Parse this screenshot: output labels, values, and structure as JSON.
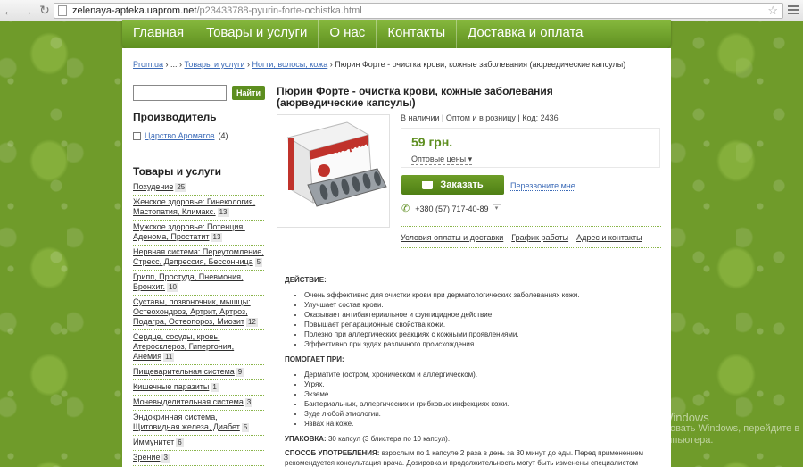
{
  "browser": {
    "url_host": "zelenaya-apteka.uaprom.net",
    "url_path": "/p23433788-pyurin-forte-ochistka.html"
  },
  "nav": [
    "Главная",
    "Товары и услуги",
    "О нас",
    "Контакты",
    "Доставка и оплата"
  ],
  "breadcrumb": {
    "items": [
      "Prom.ua",
      "...",
      "Товары и услуги",
      "Ногти, волосы, кожа"
    ],
    "current": "Пюрин Форте - очистка крови, кожные заболевания (аюрведические капсулы)"
  },
  "search": {
    "button": "Найти",
    "placeholder": ""
  },
  "sidebar": {
    "manufacturer_title": "Производитель",
    "manufacturer": {
      "name": "Царство Ароматов",
      "count": "(4)"
    },
    "categories_title": "Товары и услуги",
    "categories": [
      {
        "label": "Похудение",
        "count": "25"
      },
      {
        "label": "Женское здоровье: Гинекология, Мастопатия, Климакс.",
        "count": "13"
      },
      {
        "label": "Мужское здоровье: Потенция, Аденома, Простатит",
        "count": "13"
      },
      {
        "label": "Нервная система: Переутомление, Стресс, Депрессия, Бессонница",
        "count": "5"
      },
      {
        "label": "Грипп, Простуда, Пневмония, Бронхит.",
        "count": "10"
      },
      {
        "label": "Суставы, позвоночник, мышцы: Остеохондроз, Артрит, Артроз, Подагра, Остеопороз, Миозит",
        "count": "12"
      },
      {
        "label": "Сердце, сосуды, кровь: Атеросклероз, Гипертония, Анемия",
        "count": "11"
      },
      {
        "label": "Пищеварительная система",
        "count": "9"
      },
      {
        "label": "Кишечные паразиты",
        "count": "1"
      },
      {
        "label": "Мочевыделительная система",
        "count": "3"
      },
      {
        "label": "Эндокринная система, Щитовидная железа, Диабет",
        "count": "5"
      },
      {
        "label": "Иммунитет",
        "count": "6"
      },
      {
        "label": "Зрение",
        "count": "3"
      }
    ]
  },
  "product": {
    "title": "Пюрин Форте - очистка крови, кожные заболевания (аюрведические капсулы)",
    "meta": "В наличии | Оптом и в розницу | Код: 2436",
    "price": "59 грн.",
    "price_options": "Оптовые цены",
    "order_button": "Заказать",
    "callback": "Перезвоните мне",
    "phone": "+380 (57) 717-40-89",
    "links": [
      "Условия оплаты и доставки",
      "График работы",
      "Адрес и контакты"
    ],
    "box_label": "Пюрин"
  },
  "description": {
    "action_title": "ДЕЙСТВИЕ:",
    "action_items": [
      "Очень эффективно для очистки крови при дерматологических заболеваниях кожи.",
      "Улучшает состав крови.",
      "Оказывает антибактериальное и фунгицидное действие.",
      "Повышает репарационные свойства кожи.",
      "Полезно при аллергических реакциях с кожными проявлениями.",
      "Эффективно при зудах различного происхождения."
    ],
    "helps_title": "ПОМОГАЕТ ПРИ:",
    "helps_items": [
      "Дерматите (остром, хроническом и аллергическом).",
      "Угрях.",
      "Экземе.",
      "Бактериальных, аллергических и грибковых инфекциях кожи.",
      "Зуде любой этиологии.",
      "Язвах на коже."
    ],
    "package_label": "УПАКОВКА:",
    "package_text": "30 капсул (3 блистера по 10 капсул).",
    "usage_label": "СПОСОБ УПОТРЕБЛЕНИЯ:",
    "usage_text": "взрослым по 1 капсуле 2 раза в день за 30 минут до еды. Перед применением рекомендуется консультация врача. Дозировка и продолжительность могут быть изменены специалистом"
  },
  "watermark": {
    "line1": "Активация Windows",
    "line2": "Чтобы активировать Windows, перейдите в",
    "line3": "параметры компьютера."
  },
  "colors": {
    "accent": "#5d8e1f",
    "link": "#3b6ab7",
    "background": "#6f9b2a"
  }
}
